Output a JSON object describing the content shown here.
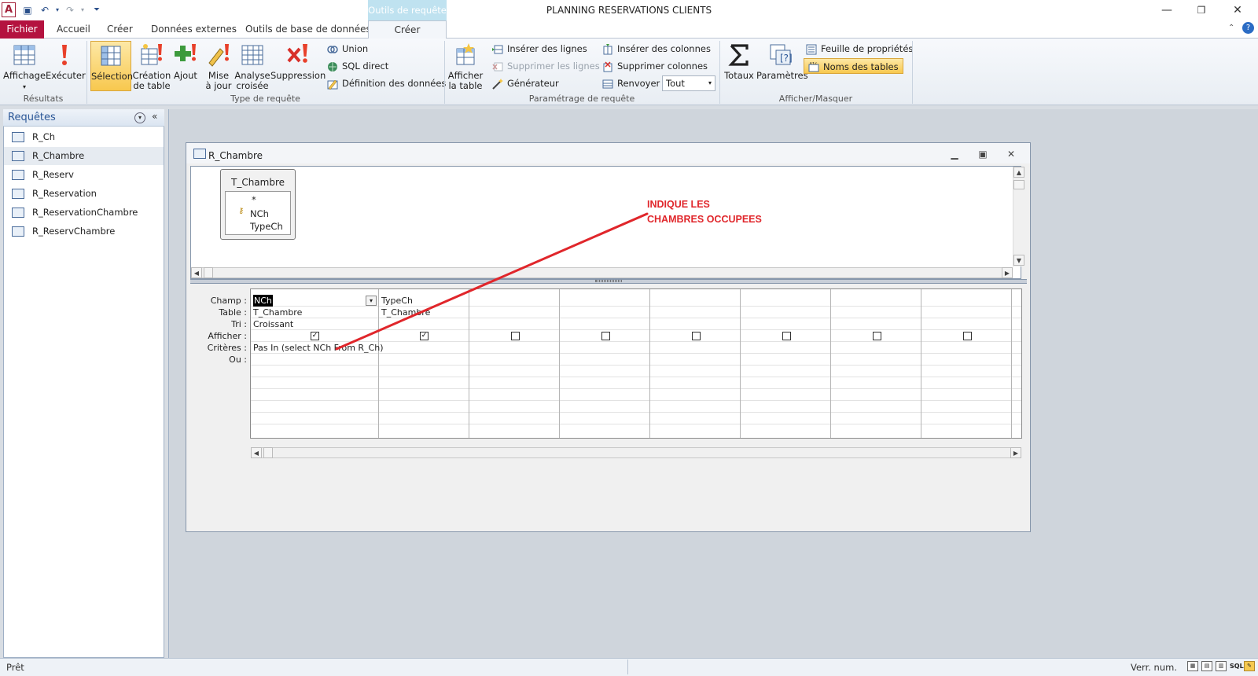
{
  "window": {
    "title": "PLANNING RESERVATIONS CLIENTS"
  },
  "ribbon": {
    "contextual_header": "Outils de requête",
    "tabs": [
      "Fichier",
      "Accueil",
      "Créer",
      "Données externes",
      "Outils de base de données",
      "Créer"
    ],
    "groups": {
      "resultats": {
        "label": "Résultats",
        "affichage": "Affichage",
        "executer": "Exécuter"
      },
      "type_requete": {
        "label": "Type de requête",
        "selection": "Sélection",
        "creation_table": [
          "Création",
          "de table"
        ],
        "ajout": "Ajout",
        "mise_a_jour": [
          "Mise",
          "à jour"
        ],
        "analyse_croisee": [
          "Analyse",
          "croisée"
        ],
        "suppression": "Suppression",
        "union": "Union",
        "sql_direct": "SQL direct",
        "definition_donnees": "Définition des données"
      },
      "parametrage": {
        "label": "Paramétrage de requête",
        "afficher_table": [
          "Afficher",
          "la table"
        ],
        "inserer_lignes": "Insérer des lignes",
        "supprimer_lignes": "Supprimer les lignes",
        "generateur": "Générateur",
        "inserer_colonnes": "Insérer des colonnes",
        "supprimer_colonnes": "Supprimer colonnes",
        "renvoyer_label": "Renvoyer :",
        "renvoyer_value": "Tout"
      },
      "afficher_masquer": {
        "label": "Afficher/Masquer",
        "totaux": "Totaux",
        "parametres": "Paramètres",
        "feuille_proprietes": "Feuille de propriétés",
        "noms_tables": "Noms des tables"
      }
    }
  },
  "nav": {
    "title": "Requêtes",
    "items": [
      "R_Ch",
      "R_Chambre",
      "R_Reserv",
      "R_Reservation",
      "R_ReservationChambre",
      "R_ReservChambre"
    ],
    "active_index": 1
  },
  "query_window": {
    "title": "R_Chambre",
    "table": {
      "name": "T_Chambre",
      "fields": [
        "*",
        "NCh",
        "TypeCh"
      ],
      "primary_key": "NCh"
    },
    "row_labels": [
      "Champ :",
      "Table :",
      "Tri :",
      "Afficher :",
      "Critères :",
      "Ou :"
    ],
    "columns": [
      {
        "champ": "NCh",
        "table": "T_Chambre",
        "tri": "Croissant",
        "afficher": true,
        "criteres": "Pas In (select NCh From R_Ch)"
      },
      {
        "champ": "TypeCh",
        "table": "T_Chambre",
        "tri": "",
        "afficher": true,
        "criteres": ""
      },
      {
        "champ": "",
        "table": "",
        "tri": "",
        "afficher": false,
        "criteres": ""
      },
      {
        "champ": "",
        "table": "",
        "tri": "",
        "afficher": false,
        "criteres": ""
      },
      {
        "champ": "",
        "table": "",
        "tri": "",
        "afficher": false,
        "criteres": ""
      },
      {
        "champ": "",
        "table": "",
        "tri": "",
        "afficher": false,
        "criteres": ""
      },
      {
        "champ": "",
        "table": "",
        "tri": "",
        "afficher": false,
        "criteres": ""
      },
      {
        "champ": "",
        "table": "",
        "tri": "",
        "afficher": false,
        "criteres": ""
      }
    ]
  },
  "annotation": {
    "lines": [
      "INDIQUE LES",
      "CHAMBRES OCCUPEES"
    ],
    "color": "#e0262b"
  },
  "status": {
    "left": "Prêt",
    "right": "Verr. num.",
    "sql": "SQL"
  },
  "colors": {
    "fichier_tab": "#b4123f",
    "contextual": "#bfe2f0",
    "selected_button": "#f8c84e"
  }
}
